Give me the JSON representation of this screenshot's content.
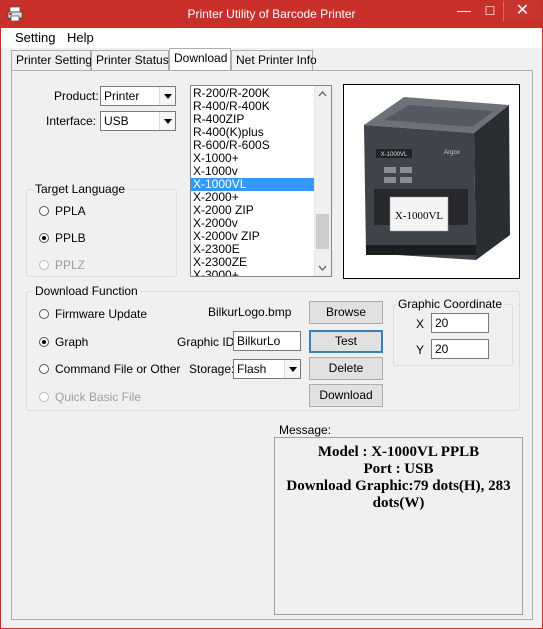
{
  "window": {
    "title": "Printer Utility of Barcode Printer"
  },
  "controls": {
    "minimize": "—",
    "maximize": "☐",
    "close": "✕"
  },
  "menu": {
    "setting": "Setting",
    "help": "Help"
  },
  "tabs": [
    "Printer Setting",
    "Printer Status",
    "Download",
    "Net Printer Info"
  ],
  "active_tab": "Download",
  "product": {
    "label": "Product:",
    "value": "Printer"
  },
  "interface": {
    "label": "Interface:",
    "value": "USB"
  },
  "models": {
    "items": [
      "R-200/R-200K",
      "R-400/R-400K",
      "R-400ZIP",
      "R-400(K)plus",
      "R-600/R-600S",
      "X-1000+",
      "X-1000v",
      "X-1000VL",
      "X-2000+",
      "X-2000 ZIP",
      "X-2000v",
      "X-2000v ZIP",
      "X-2300E",
      "X-2300ZE",
      "X-3000+"
    ],
    "selected": "X-1000VL"
  },
  "target_language": {
    "title": "Target Language",
    "options": [
      {
        "label": "PPLA",
        "checked": false,
        "enabled": true
      },
      {
        "label": "PPLB",
        "checked": true,
        "enabled": true
      },
      {
        "label": "PPLZ",
        "checked": false,
        "enabled": false
      }
    ]
  },
  "printer_image": {
    "label_text": "X-1000VL",
    "badge_text": "X-1000VL",
    "brand_text": "Argox"
  },
  "download_function": {
    "title": "Download Function",
    "options": [
      {
        "label": "Firmware Update",
        "checked": false,
        "enabled": true
      },
      {
        "label": "Graph",
        "checked": true,
        "enabled": true
      },
      {
        "label": "Command File or Other",
        "checked": false,
        "enabled": true
      },
      {
        "label": "Quick Basic File",
        "checked": false,
        "enabled": false
      }
    ],
    "file_value": "BilkurLogo.bmp",
    "browse_label": "Browse",
    "graphic_id_label": "Graphic ID:",
    "graphic_id_value": "BilkurLo",
    "test_label": "Test",
    "storage_label": "Storage:",
    "storage_value": "Flash",
    "delete_label": "Delete",
    "download_label": "Download"
  },
  "graphic_coordinate": {
    "title": "Graphic Coordinate",
    "x_label": "X",
    "x_value": "20",
    "y_label": "Y",
    "y_value": "20"
  },
  "message": {
    "label": "Message:",
    "line1": "Model : X-1000VL PPLB",
    "line2": "Port : USB",
    "line3": "Download Graphic:79 dots(H), 283 dots(W)"
  }
}
